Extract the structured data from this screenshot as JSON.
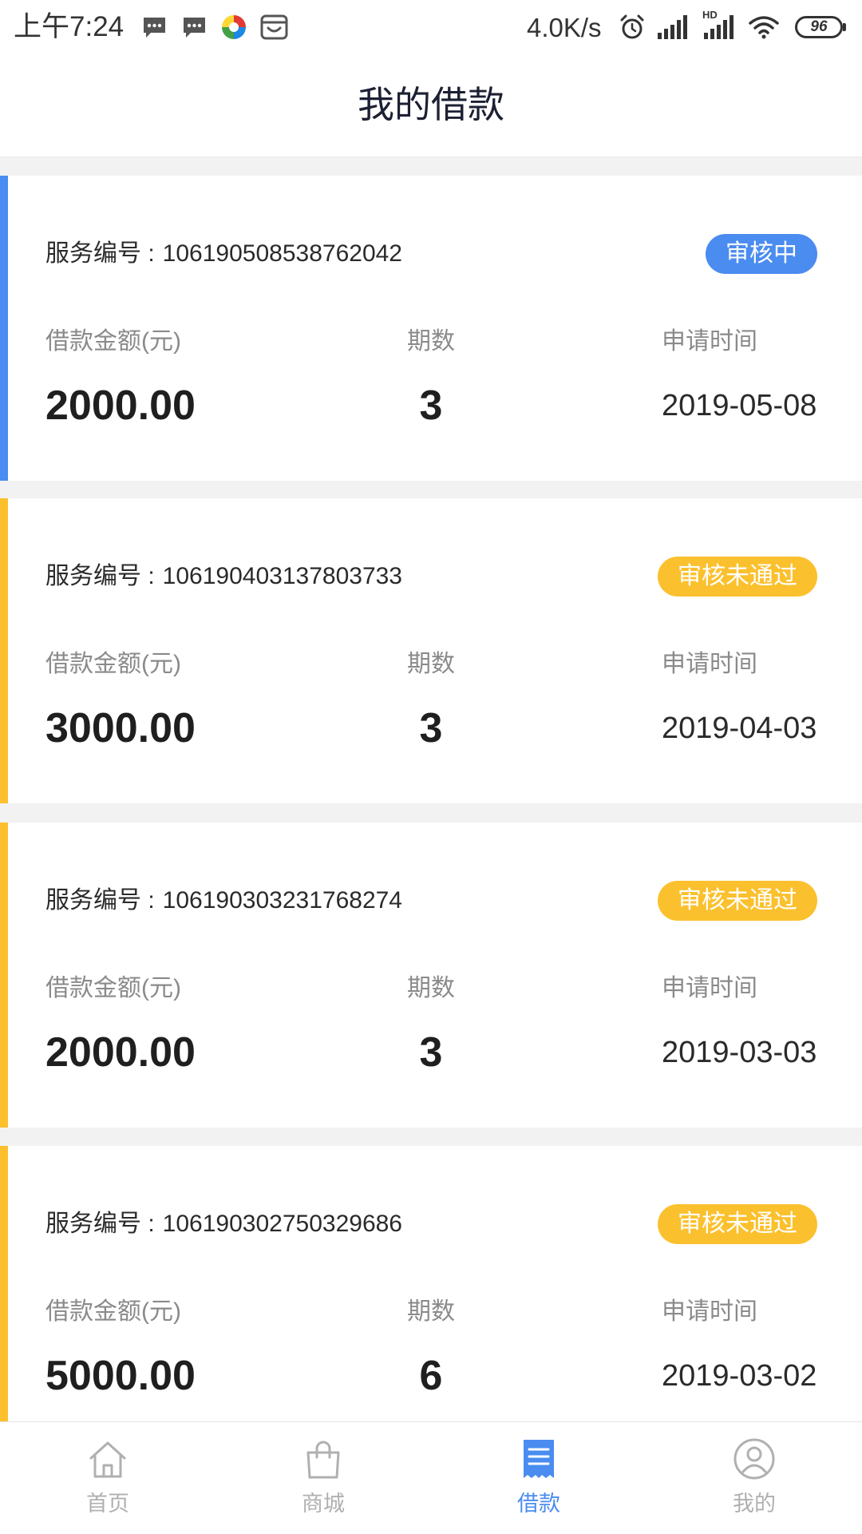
{
  "status_bar": {
    "time": "上午7:24",
    "left_icons": [
      "message-icon",
      "message-icon",
      "app-icon",
      "store-icon"
    ],
    "net_speed": "4.0K/s",
    "right_icons": [
      "alarm-icon",
      "signal-icon",
      "hd-signal-icon",
      "wifi-icon",
      "battery-icon"
    ],
    "hd_label": "HD",
    "battery": "96"
  },
  "header": {
    "title": "我的借款"
  },
  "labels": {
    "service_no": "服务编号 :",
    "amount": "借款金额(元)",
    "periods": "期数",
    "apply_time": "申请时间"
  },
  "cards": [
    {
      "service_no": "106190508538762042",
      "status": "审核中",
      "status_color": "#4a8cf0",
      "amount": "2000.00",
      "periods": "3",
      "apply_date": "2019-05-08"
    },
    {
      "service_no": "106190403137803733",
      "status": "审核未通过",
      "status_color": "#fbc02d",
      "amount": "3000.00",
      "periods": "3",
      "apply_date": "2019-04-03"
    },
    {
      "service_no": "106190303231768274",
      "status": "审核未通过",
      "status_color": "#fbc02d",
      "amount": "2000.00",
      "periods": "3",
      "apply_date": "2019-03-03"
    },
    {
      "service_no": "106190302750329686",
      "status": "审核未通过",
      "status_color": "#fbc02d",
      "amount": "5000.00",
      "periods": "6",
      "apply_date": "2019-03-02"
    }
  ],
  "bottom_nav": {
    "active_color": "#4a8cf0",
    "inactive_color": "#b0b0b0",
    "items": [
      {
        "label": "首页",
        "icon": "home-icon",
        "active": false
      },
      {
        "label": "商城",
        "icon": "shopping-bag-icon",
        "active": false
      },
      {
        "label": "借款",
        "icon": "loan-document-icon",
        "active": true
      },
      {
        "label": "我的",
        "icon": "user-icon",
        "active": false
      }
    ]
  }
}
